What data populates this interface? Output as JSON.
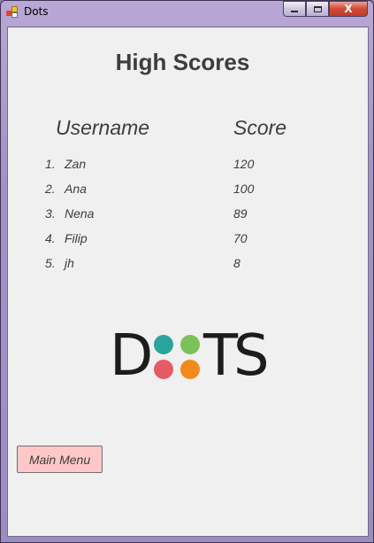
{
  "window": {
    "title": "Dots",
    "controls": {
      "minimize": "",
      "maximize": "",
      "close": "X"
    }
  },
  "page": {
    "heading": "High Scores",
    "columns": {
      "username": "Username",
      "score": "Score"
    },
    "rows": [
      {
        "rank": "1.",
        "username": "Zan",
        "score": "120"
      },
      {
        "rank": "2.",
        "username": "Ana",
        "score": "100"
      },
      {
        "rank": "3.",
        "username": "Nena",
        "score": "89"
      },
      {
        "rank": "4.",
        "username": "Filip",
        "score": "70"
      },
      {
        "rank": "5.",
        "username": "jh",
        "score": "8"
      }
    ]
  },
  "logo": {
    "text": "DOTS",
    "letter_d": "D",
    "letter_t": "T",
    "letter_s": "S",
    "dot_colors": [
      "#2aa39c",
      "#7bc15a",
      "#e45b64",
      "#f08a1d"
    ]
  },
  "buttons": {
    "main_menu": "Main Menu"
  },
  "colors": {
    "client_background": "#f0f0f0",
    "text": "#3d3d3d",
    "main_menu_background": "#ffc7c7"
  }
}
